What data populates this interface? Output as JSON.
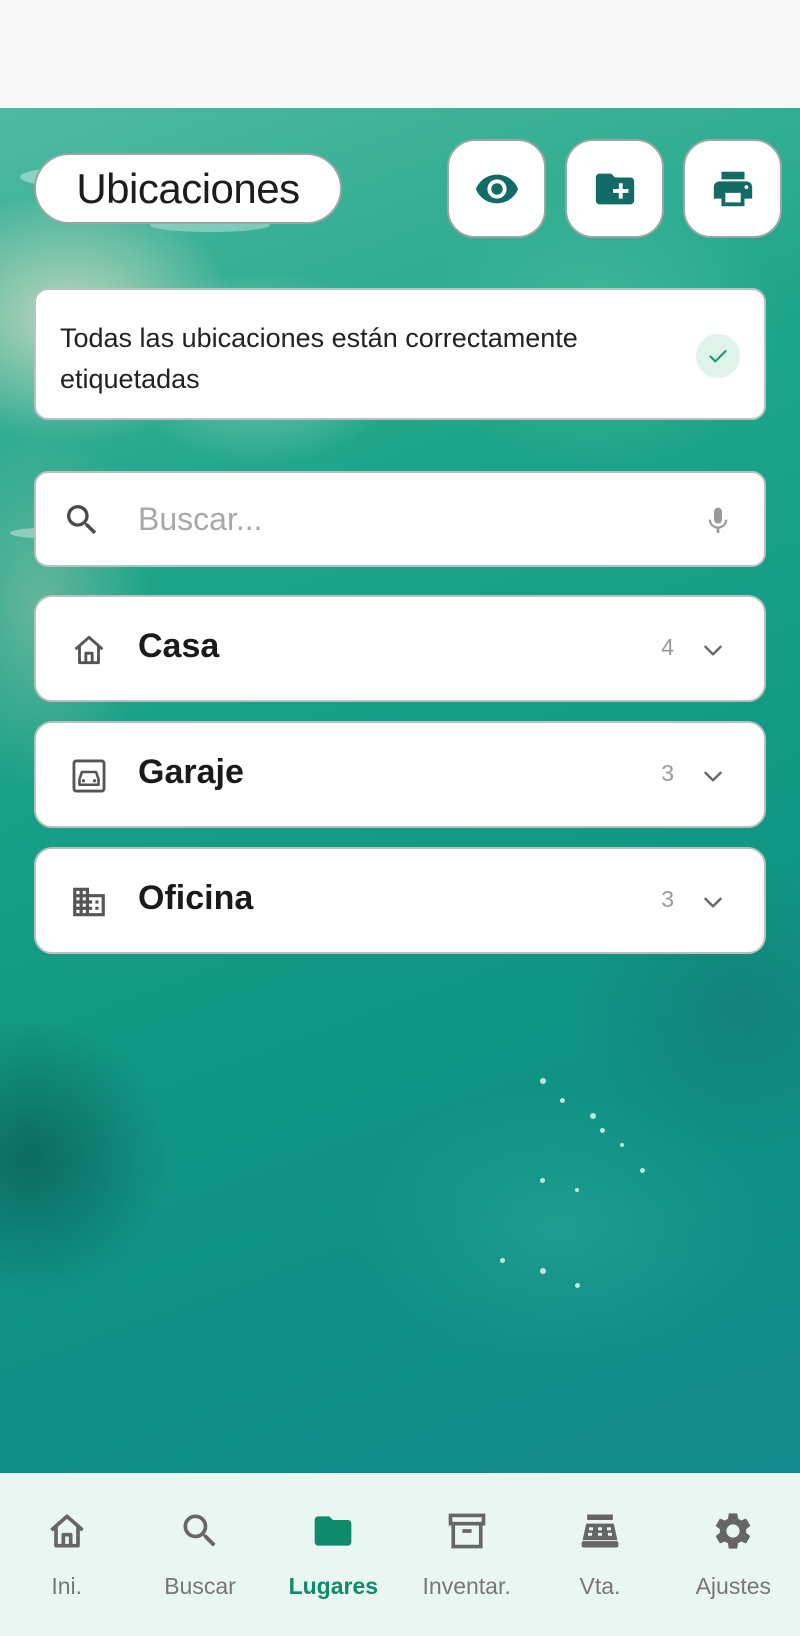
{
  "header": {
    "title": "Ubicaciones",
    "actions": [
      {
        "icon": "eye-icon"
      },
      {
        "icon": "folder-add-icon"
      },
      {
        "icon": "printer-icon"
      }
    ]
  },
  "banner": {
    "text": "Todas las ubicaciones están correctamente etiquetadas",
    "status_icon": "check-icon"
  },
  "search": {
    "placeholder": "Buscar...",
    "value": ""
  },
  "locations": [
    {
      "name": "Casa",
      "count": "4",
      "icon": "house-icon"
    },
    {
      "name": "Garaje",
      "count": "3",
      "icon": "garage-icon"
    },
    {
      "name": "Oficina",
      "count": "3",
      "icon": "office-building-icon"
    }
  ],
  "nav": {
    "active_index": 2,
    "items": [
      {
        "label": "Ini.",
        "icon": "home-icon"
      },
      {
        "label": "Buscar",
        "icon": "search-icon"
      },
      {
        "label": "Lugares",
        "icon": "folder-icon"
      },
      {
        "label": "Inventar.",
        "icon": "archive-icon"
      },
      {
        "label": "Vta.",
        "icon": "cash-register-icon"
      },
      {
        "label": "Ajustes",
        "icon": "gear-icon"
      }
    ]
  },
  "colors": {
    "accent": "#0f8a6a",
    "icon_teal": "#126b64",
    "check_bg": "#dff3ea",
    "nav_bg": "#e9f6f1"
  }
}
